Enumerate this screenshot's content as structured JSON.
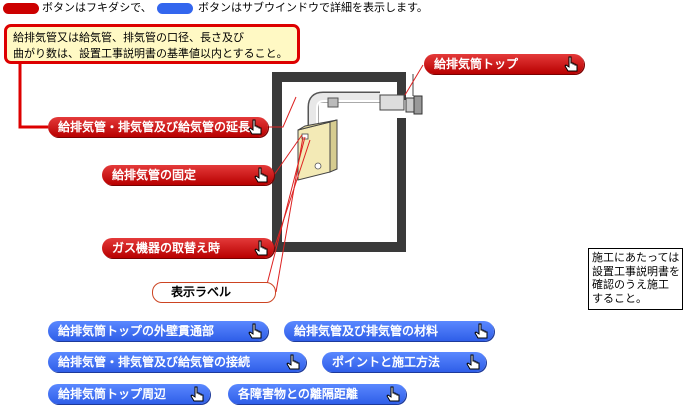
{
  "legend": {
    "red_text": "ボタンはフキダシで、",
    "blue_text": "ボタンはサブウインドウで詳細を表示します。"
  },
  "callout": {
    "line1": "給排気管又は給気管、排気管の口径、長さ及び",
    "line2": "曲がり数は、設置工事説明書の基準値以内とすること。"
  },
  "red_buttons": {
    "top_label": "給排気筒トップ",
    "extension_label": "給排気管・排気管及び給気管の延長",
    "fixing_label": "給排気管の固定",
    "replace_label": "ガス機器の取替え時"
  },
  "display_label": "表示ラベル",
  "note": {
    "line1": "施工にあたっては",
    "line2": "設置工事説明書を",
    "line3": "確認のうえ施工",
    "line4": "すること。"
  },
  "blue_buttons": {
    "wall_penetration_label": "給排気筒トップの外壁貫通部",
    "materials_label": "給排気管及び排気管の材料",
    "connection_label": "給排気管・排気管及び給気管の接続",
    "points_label": "ポイントと施工方法",
    "surroundings_label": "給排気筒トップ周辺",
    "clearance_label": "各障害物との離隔距離"
  },
  "colors": {
    "red_button": "#cc0000",
    "blue_button": "#3366ee",
    "callout_border": "#dd0000",
    "callout_fill": "#fff9c4",
    "wall": "#3a3a3a",
    "heater_fill": "#f3eab6"
  },
  "icons": [
    "hand-pointer-icon"
  ]
}
